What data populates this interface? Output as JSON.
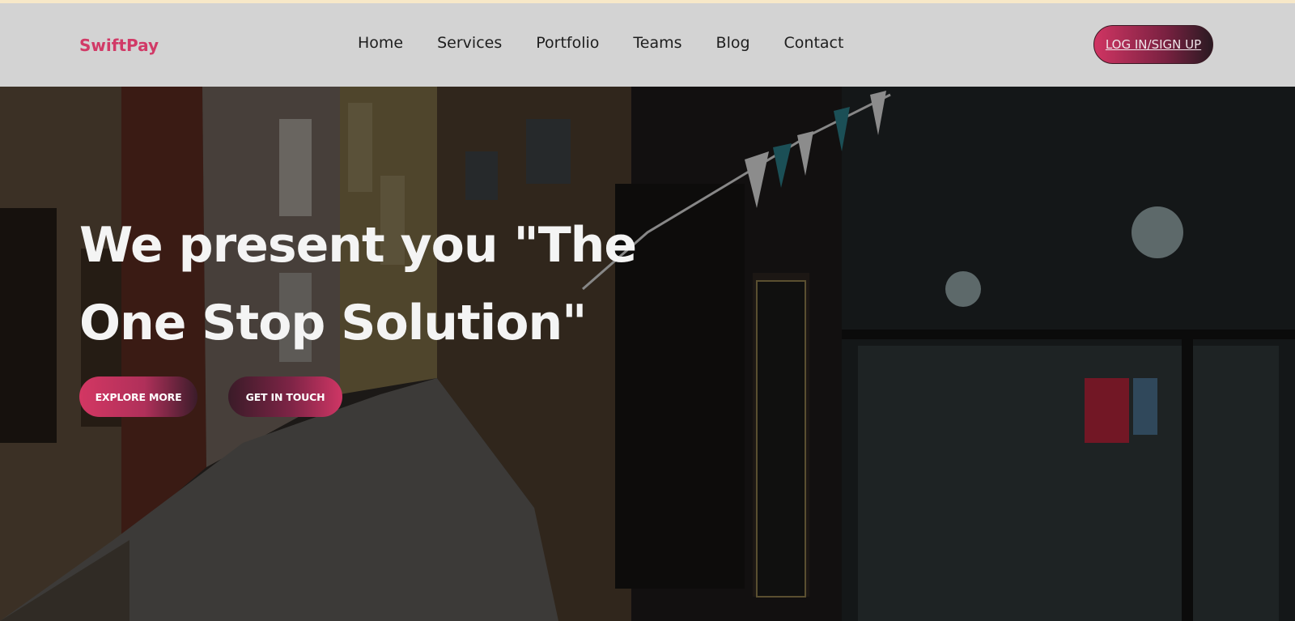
{
  "header": {
    "brand": "SwiftPay",
    "nav": [
      "Home",
      "Services",
      "Portfolio",
      "Teams",
      "Blog",
      "Contact"
    ],
    "login_label": "LOG IN/SIGN UP"
  },
  "hero": {
    "title": "We present you \"The One Stop Solution\"",
    "explore_label": "EXPLORE MORE",
    "touch_label": "GET IN TOUCH"
  },
  "colors": {
    "brand": "#d13a67",
    "nav_background": "#d3d3d3",
    "accent_dark": "#2a1a22",
    "hero_text": "#f4f4f4"
  }
}
